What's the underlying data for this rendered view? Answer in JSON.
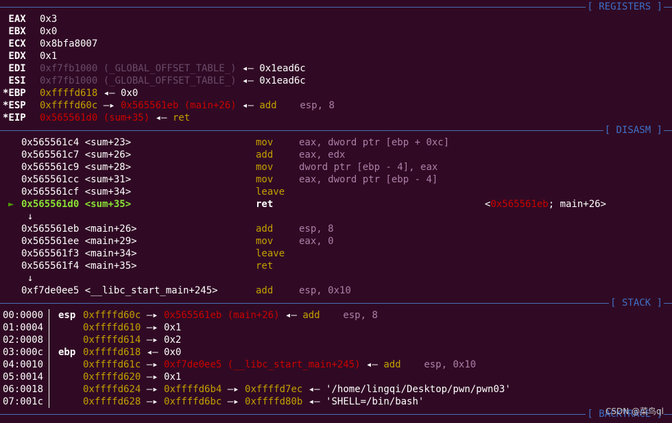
{
  "sections": {
    "registers": "[ REGISTERS ]",
    "disasm": "[ DISASM ]",
    "stack": "[ STACK ]",
    "backtrace": "[ BACKTRACE ]"
  },
  "registers": [
    {
      "name": " EAX",
      "value": "0x3"
    },
    {
      "name": " EBX",
      "value": "0x0"
    },
    {
      "name": " ECX",
      "value": "0x8bfa8007"
    },
    {
      "name": " EDX",
      "value": "0x1"
    },
    {
      "name": " EDI",
      "addr": "0xf7fb1000 (_GLOBAL_OFFSET_TABLE_)",
      "arrow": "◂—",
      "value": "0x1ead6c"
    },
    {
      "name": " ESI",
      "addr": "0xf7fb1000 (_GLOBAL_OFFSET_TABLE_)",
      "arrow": "◂—",
      "value": "0x1ead6c"
    },
    {
      "name": "*EBP",
      "addr": "0xffffd618",
      "arrow": "◂—",
      "value": "0x0"
    },
    {
      "name": "*ESP",
      "addr": "0xffffd60c",
      "arrow1": "—▸",
      "target": "0x565561eb (main+26)",
      "arrow": "◂—",
      "op": "add",
      "args": "esp,",
      "imm": "8"
    },
    {
      "name": "*EIP",
      "target": "0x565561d0 (sum+35)",
      "arrow": "◂—",
      "op": "ret"
    }
  ],
  "disasm": [
    {
      "addr": "0x565561c4 <sum+23>",
      "op": "mov",
      "args": "eax, dword ptr [ebp + ",
      "imm": "0xc",
      "tail": "]"
    },
    {
      "addr": "0x565561c7 <sum+26>",
      "op": "add",
      "args": "eax, edx",
      "imm": "",
      "tail": ""
    },
    {
      "addr": "0x565561c9 <sum+28>",
      "op": "mov",
      "args": "dword ptr [ebp - ",
      "imm": "4",
      "tail": "], eax"
    },
    {
      "addr": "0x565561cc <sum+31>",
      "op": "mov",
      "args": "eax, dword ptr [ebp - ",
      "imm": "4",
      "tail": "]"
    },
    {
      "addr": "0x565561cf <sum+34>",
      "op": "leave",
      "args": "",
      "imm": "",
      "tail": ""
    },
    {
      "addr": "0x565561d0 <sum+35>",
      "op": "ret",
      "current": true,
      "marker": "►",
      "comment_pre": "<",
      "comment_addr": "0x565561eb",
      "comment_post": "; main+26>"
    },
    {
      "arrow": "↓"
    },
    {
      "addr": "0x565561eb <main+26>",
      "op": "add",
      "args": "esp, ",
      "imm": "8",
      "tail": ""
    },
    {
      "addr": "0x565561ee <main+29>",
      "op": "mov",
      "args": "eax, ",
      "imm": "0",
      "tail": ""
    },
    {
      "addr": "0x565561f3 <main+34>",
      "op": "leave",
      "args": "",
      "imm": "",
      "tail": ""
    },
    {
      "addr": "0x565561f4 <main+35>",
      "op": "ret",
      "args": "",
      "imm": "",
      "tail": ""
    },
    {
      "arrow": "↓"
    },
    {
      "addr": "0xf7de0ee5 <__libc_start_main+245>",
      "op": "add",
      "args": "esp, ",
      "imm": "0x10",
      "tail": ""
    }
  ],
  "stack": [
    {
      "off": "00:0000",
      "reg": "esp",
      "addr": "0xffffd60c",
      "a1": "—▸",
      "v1": "0x565561eb (main+26)",
      "v1c": "r",
      "a2": "◂—",
      "op": "add",
      "args": "esp,",
      "imm": "8"
    },
    {
      "off": "01:0004",
      "reg": "",
      "addr": "0xffffd610",
      "a1": "—▸",
      "v1": "0x1",
      "v1c": "w"
    },
    {
      "off": "02:0008",
      "reg": "",
      "addr": "0xffffd614",
      "a1": "—▸",
      "v1": "0x2",
      "v1c": "w"
    },
    {
      "off": "03:000c",
      "reg": "ebp",
      "addr": "0xffffd618",
      "a1": "◂—",
      "v1": "0x0",
      "v1c": "w"
    },
    {
      "off": "04:0010",
      "reg": "",
      "addr": "0xffffd61c",
      "a1": "—▸",
      "v1": "0xf7de0ee5 (__libc_start_main+245)",
      "v1c": "r",
      "a2": "◂—",
      "op": "add",
      "args": "esp,",
      "imm": "0x10"
    },
    {
      "off": "05:0014",
      "reg": "",
      "addr": "0xffffd620",
      "a1": "—▸",
      "v1": "0x1",
      "v1c": "w"
    },
    {
      "off": "06:0018",
      "reg": "",
      "addr": "0xffffd624",
      "a1": "—▸",
      "v1": "0xffffd6b4",
      "v1c": "y",
      "a2": "—▸",
      "v2": "0xffffd7ec",
      "a3": "◂—",
      "str": "'/home/lingqi/Desktop/pwn/pwn03'"
    },
    {
      "off": "07:001c",
      "reg": "",
      "addr": "0xffffd628",
      "a1": "—▸",
      "v1": "0xffffd6bc",
      "v1c": "y",
      "a2": "—▸",
      "v2": "0xffffd80b",
      "a3": "◂—",
      "str": "'SHELL=/bin/bash'"
    }
  ],
  "watermark": "CSDN @菜鸟ql"
}
